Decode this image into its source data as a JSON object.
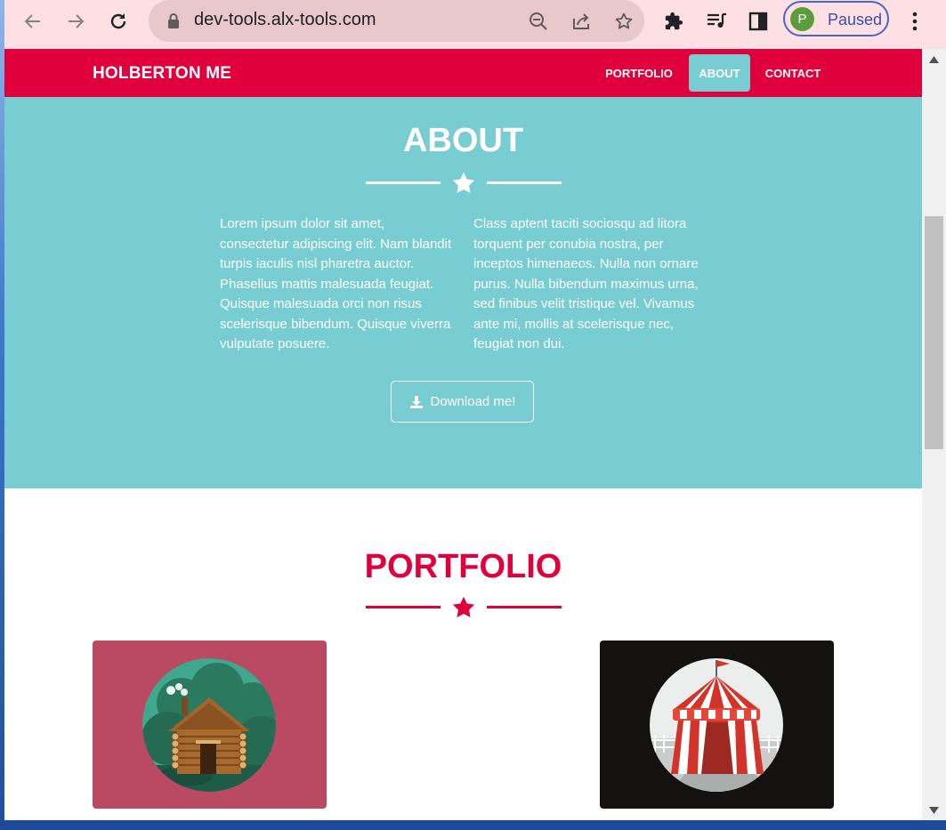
{
  "browser": {
    "url": "dev-tools.alx-tools.com",
    "profile": {
      "initial": "P",
      "status": "Paused"
    },
    "icons": {
      "back": "arrow-left-icon",
      "forward": "arrow-right-icon",
      "reload": "reload-icon",
      "lock": "lock-icon",
      "zoom": "zoom-out-icon",
      "share": "share-icon",
      "bookmark": "star-outline-icon",
      "extensions": "puzzle-icon",
      "media": "media-queue-icon",
      "sidepanel": "side-panel-icon",
      "menu": "kebab-menu-icon"
    }
  },
  "site": {
    "brand": "HOLBERTON ME",
    "nav": [
      {
        "label": "PORTFOLIO",
        "active": false
      },
      {
        "label": "ABOUT",
        "active": true
      },
      {
        "label": "CONTACT",
        "active": false
      }
    ],
    "about": {
      "title": "ABOUT",
      "col1": "Lorem ipsum dolor sit amet, consectetur adipiscing elit. Nam blandit turpis iaculis nisl pharetra auctor. Phasellus mattis malesuada feugiat. Quisque malesuada orci non risus scelerisque bibendum. Quisque viverra vulputate posuere.",
      "col2": "Class aptent taciti sociosqu ad litora torquent per conubia nostra, per inceptos himenaeos. Nulla non ornare purus. Nulla bibendum maximus urna, sed finibus velit tristique vel. Vivamus ante mi, mollis at scelerisque nec, feugiat non dui.",
      "download": "Download me!"
    },
    "portfolio": {
      "title": "PORTFOLIO",
      "items": [
        {
          "image": "log-cabin-illustration"
        },
        {
          "image": "circus-tent-illustration"
        }
      ]
    }
  },
  "colors": {
    "primary": "#e0003c",
    "secondary": "#78cdd2",
    "browser_toolbar": "#fde0e3",
    "card1_bg": "#b94a62",
    "card2_bg": "#141111"
  }
}
